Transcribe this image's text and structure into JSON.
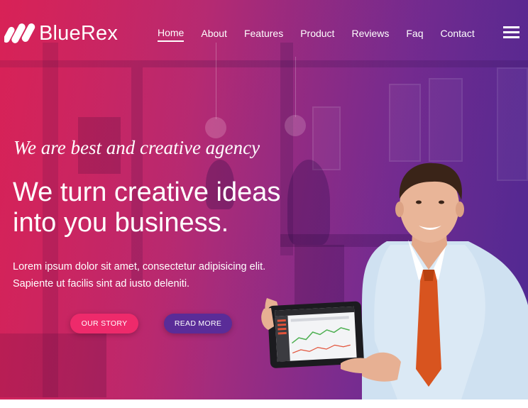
{
  "brand": {
    "name": "BlueRex",
    "logo_icon": "bluerex-stripes-icon"
  },
  "nav": {
    "items": [
      {
        "label": "Home",
        "active": true
      },
      {
        "label": "About",
        "active": false
      },
      {
        "label": "Features",
        "active": false
      },
      {
        "label": "Product",
        "active": false
      },
      {
        "label": "Reviews",
        "active": false
      },
      {
        "label": "Faq",
        "active": false
      },
      {
        "label": "Contact",
        "active": false
      }
    ],
    "menu_icon": "hamburger-menu-icon"
  },
  "hero": {
    "tagline": "We are best and creative agency",
    "headline_line1": "We turn creative ideas",
    "headline_line2": "into you business.",
    "description_line1": "Lorem ipsum dolor sit amet, consectetur adipisicing elit.",
    "description_line2": "Sapiente ut facilis sint ad iusto deleniti.",
    "button_primary": "Our Story",
    "button_secondary": "Read More"
  },
  "colors": {
    "gradient_start": "#d6245a",
    "gradient_end": "#55309c",
    "button_primary": "#ee2a6b",
    "button_secondary": "#5a2c98",
    "text": "#ffffff"
  }
}
